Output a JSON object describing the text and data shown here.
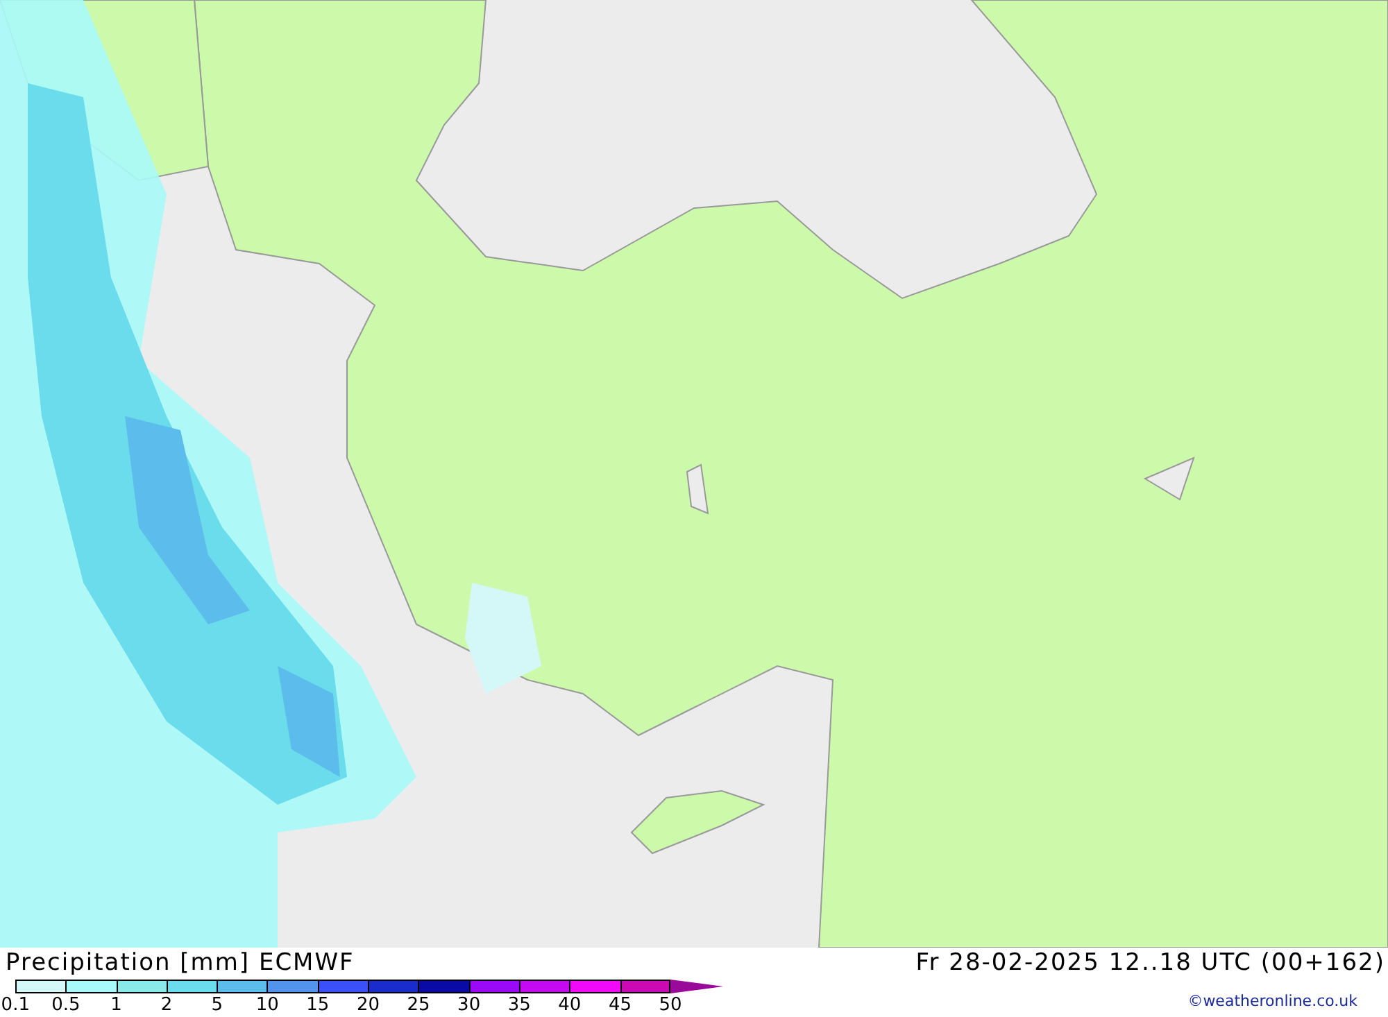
{
  "title": "Precipitation [mm] ECMWF",
  "valid_time": "Fr 28-02-2025 12..18 UTC (00+162)",
  "credit": "©weatheronline.co.uk",
  "legend": {
    "bins": [
      {
        "color": "#d4f7f7"
      },
      {
        "color": "#a8fafa"
      },
      {
        "color": "#8aeaea"
      },
      {
        "color": "#6adcec"
      },
      {
        "color": "#5cbcec"
      },
      {
        "color": "#5294ec"
      },
      {
        "color": "#3a50f8"
      },
      {
        "color": "#1a2ccc"
      },
      {
        "color": "#0a0aa4"
      },
      {
        "color": "#9a0af8"
      },
      {
        "color": "#c40af0"
      },
      {
        "color": "#f00af8"
      },
      {
        "color": "#cc0ab4"
      }
    ],
    "arrow": {
      "color": "#9a0a9a"
    },
    "ticks": [
      "0.1",
      "0.5",
      "1",
      "2",
      "5",
      "10",
      "15",
      "20",
      "25",
      "30",
      "35",
      "40",
      "45",
      "50"
    ]
  }
}
